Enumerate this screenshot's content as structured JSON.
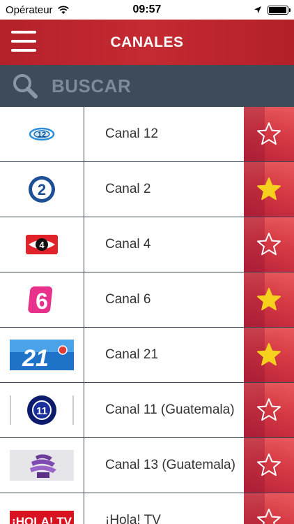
{
  "status_bar": {
    "carrier": "Opérateur",
    "time": "09:57",
    "battery_level": 0.95
  },
  "header": {
    "title": "CANALES"
  },
  "search": {
    "placeholder": "BUSCAR",
    "value": ""
  },
  "channels": [
    {
      "name": "Canal 12",
      "logo": "canal-12-logo",
      "favorite": false
    },
    {
      "name": "Canal 2",
      "logo": "canal-2-logo",
      "favorite": true
    },
    {
      "name": "Canal 4",
      "logo": "canal-4-logo",
      "favorite": false
    },
    {
      "name": "Canal 6",
      "logo": "canal-6-logo",
      "favorite": true
    },
    {
      "name": "Canal 21",
      "logo": "canal-21-logo",
      "favorite": true
    },
    {
      "name": "Canal 11 (Guatemala)",
      "logo": "canal-11-logo",
      "favorite": false
    },
    {
      "name": "Canal 13 (Guatemala)",
      "logo": "canal-13-logo",
      "favorite": false
    },
    {
      "name": "¡Hola! TV",
      "logo": "hola-tv-logo",
      "logo_text": "¡HOLA! TV",
      "favorite": false
    }
  ],
  "colors": {
    "header_red": "#b4212b",
    "search_bg": "#3e4b58",
    "star_favorite": "#f5d11e",
    "star_outline": "#ffffff"
  }
}
